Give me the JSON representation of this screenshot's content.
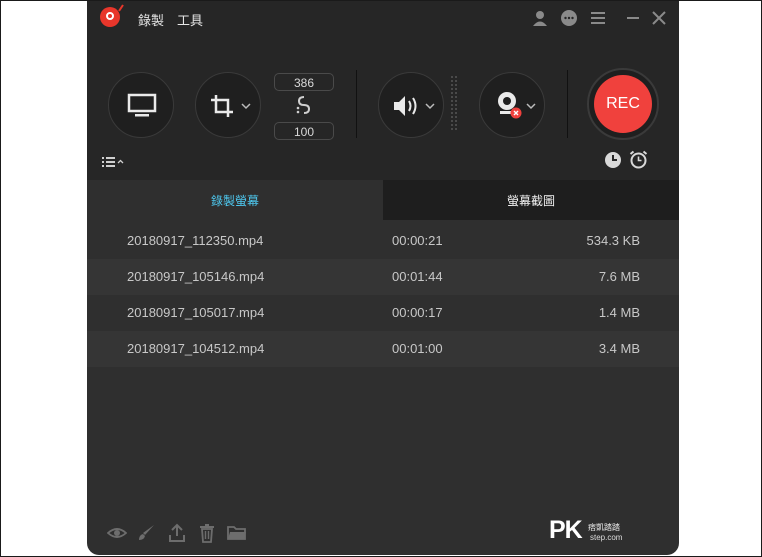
{
  "titlebar": {
    "menu": [
      "錄製",
      "工具"
    ],
    "icons": [
      "account-icon",
      "feedback-icon",
      "menu-icon",
      "minimize-icon",
      "close-icon"
    ]
  },
  "controls": {
    "width_value": "386",
    "height_value": "100",
    "rec_label": "REC"
  },
  "tabs": [
    {
      "label": "錄製螢幕",
      "active": true
    },
    {
      "label": "螢幕截圖",
      "active": false
    }
  ],
  "recordings": [
    {
      "name": "20180917_112350.mp4",
      "duration": "00:00:21",
      "size": "534.3 KB"
    },
    {
      "name": "20180917_105146.mp4",
      "duration": "00:01:44",
      "size": "7.6 MB"
    },
    {
      "name": "20180917_105017.mp4",
      "duration": "00:00:17",
      "size": "1.4 MB"
    },
    {
      "name": "20180917_104512.mp4",
      "duration": "00:01:00",
      "size": "3.4 MB"
    }
  ],
  "bottom_toolbar": [
    "preview-icon",
    "edit-icon",
    "share-icon",
    "delete-icon",
    "folder-icon"
  ],
  "watermark": {
    "pk": "PK",
    "sub": "痞凱踏踏",
    "url": "step.com"
  },
  "colors": {
    "accent": "#4ec7ee",
    "rec": "#f0413d",
    "background": "#2f2f2f"
  }
}
